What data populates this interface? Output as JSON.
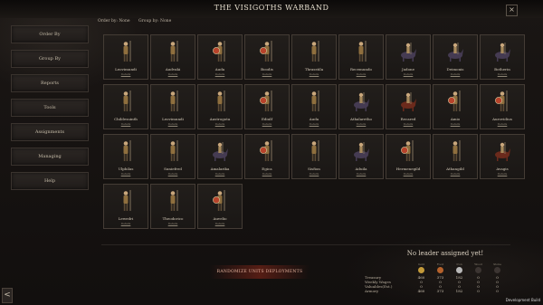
{
  "header": {
    "title": "THE VISIGOTHS WARBAND",
    "close_label": "×",
    "order_by": "Order by: None",
    "group_by": "Group by: None"
  },
  "sidebar": {
    "items": [
      {
        "label": "Order By"
      },
      {
        "label": "Group By"
      },
      {
        "label": "Reports"
      },
      {
        "label": "Tools"
      },
      {
        "label": "Assignments"
      },
      {
        "label": "Managing"
      },
      {
        "label": "Help"
      }
    ]
  },
  "units": [
    {
      "name": "Leovimundi",
      "detail": "Details",
      "type": "spearman"
    },
    {
      "name": "Audvaki",
      "detail": "Details",
      "type": "spearman"
    },
    {
      "name": "Auda",
      "detail": "Details",
      "type": "shield"
    },
    {
      "name": "Boodis",
      "detail": "Details",
      "type": "shield"
    },
    {
      "name": "Thrasstila",
      "detail": "Details",
      "type": "spearman"
    },
    {
      "name": "Recemundo",
      "detail": "Details",
      "type": "spearman"
    },
    {
      "name": "Jadone",
      "detail": "Details",
      "type": "cavalry"
    },
    {
      "name": "Deimonis",
      "detail": "Details",
      "type": "cavalry"
    },
    {
      "name": "Botherin",
      "detail": "Details",
      "type": "cavalry"
    },
    {
      "name": "Childesuinth",
      "detail": "Details",
      "type": "spearman"
    },
    {
      "name": "Leovimundi",
      "detail": "Details",
      "type": "spearman"
    },
    {
      "name": "Austrogota",
      "detail": "Details",
      "type": "spearman"
    },
    {
      "name": "Ediulf",
      "detail": "Details",
      "type": "shield"
    },
    {
      "name": "Auda",
      "detail": "Details",
      "type": "spearman"
    },
    {
      "name": "Athalaretho",
      "detail": "Details",
      "type": "cavalry"
    },
    {
      "name": "Recared",
      "detail": "Details",
      "type": "horse-red"
    },
    {
      "name": "Amio",
      "detail": "Details",
      "type": "shield"
    },
    {
      "name": "Aurovidius",
      "detail": "Details",
      "type": "shield"
    },
    {
      "name": "Ulphilas",
      "detail": "Details",
      "type": "spearman"
    },
    {
      "name": "Suniefred",
      "detail": "Details",
      "type": "spearman"
    },
    {
      "name": "Amalarika",
      "detail": "Details",
      "type": "cavalry"
    },
    {
      "name": "Egica",
      "detail": "Details",
      "type": "shield"
    },
    {
      "name": "Sisfion",
      "detail": "Details",
      "type": "spearman"
    },
    {
      "name": "Aduila",
      "detail": "Details",
      "type": "cavalry"
    },
    {
      "name": "Hermenegild",
      "detail": "Details",
      "type": "shield"
    },
    {
      "name": "Athangild",
      "detail": "Details",
      "type": "spearman"
    },
    {
      "name": "Avagis",
      "detail": "Details",
      "type": "horse-red"
    },
    {
      "name": "Lewedri",
      "detail": "Details",
      "type": "spearman"
    },
    {
      "name": "Theodorico",
      "detail": "Details",
      "type": "spearman"
    },
    {
      "name": "Auvelio",
      "detail": "Details",
      "type": "shield"
    }
  ],
  "ranks_button": "RANDOMIZE UNITS DEPLOYMENTS",
  "leader": {
    "title": "No leader assigned yet!",
    "col_heads": [
      "Gold",
      "Food",
      "Iron",
      "Wood",
      "Stone"
    ],
    "coin_colors": [
      "#c39a3a",
      "#b5622c",
      "#b9b9b9",
      "#3c3532",
      "#3c3532"
    ],
    "rows": [
      {
        "label": "Treasury",
        "values": [
          "460",
          "373",
          "182",
          "0",
          "0"
        ]
      },
      {
        "label": "Weekly Wages",
        "values": [
          "0",
          "0",
          "0",
          "0",
          "0"
        ]
      },
      {
        "label": "Valuables(Est.)",
        "values": [
          "0",
          "0",
          "0",
          "0",
          "0"
        ]
      },
      {
        "label": "Armory",
        "values": [
          "460",
          "373",
          "182",
          "0",
          "0"
        ]
      }
    ]
  },
  "footer": {
    "dev_build": "Development Build",
    "back_label": "<"
  }
}
